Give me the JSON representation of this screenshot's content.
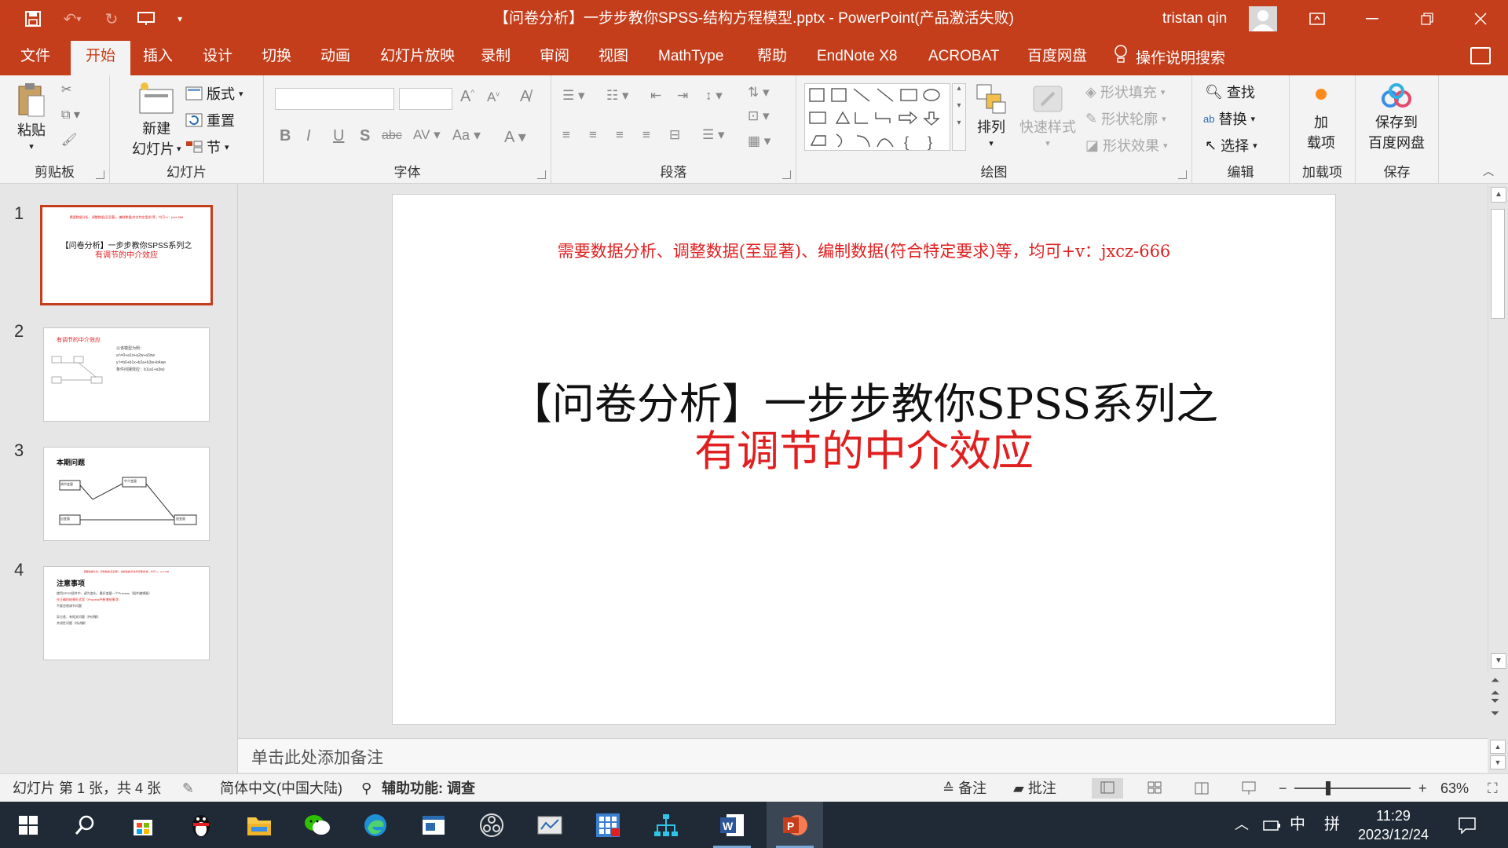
{
  "window": {
    "title": "【问卷分析】一步步教你SPSS-结构方程模型.pptx - PowerPoint(产品激活失败)",
    "user": "tristan qin"
  },
  "tabs": [
    "文件",
    "开始",
    "插入",
    "设计",
    "切换",
    "动画",
    "幻灯片放映",
    "录制",
    "审阅",
    "视图",
    "MathType",
    "帮助",
    "EndNote X8",
    "ACROBAT",
    "百度网盘"
  ],
  "active_tab": "开始",
  "tell_me": "操作说明搜索",
  "ribbon": {
    "groups": {
      "clipboard": "剪贴板",
      "slides": "幻灯片",
      "font": "字体",
      "paragraph": "段落",
      "drawing": "绘图",
      "editing": "编辑",
      "addins": "加载项",
      "save": "保存"
    },
    "paste": "粘贴",
    "new_slide_1": "新建",
    "new_slide_2": "幻灯片",
    "layout": "版式",
    "reset": "重置",
    "section": "节",
    "arrange": "排列",
    "quick_styles": "快速样式",
    "shape_fill": "形状填充",
    "shape_outline": "形状轮廓",
    "shape_effects": "形状效果",
    "find": "查找",
    "replace": "替换",
    "select": "选择",
    "addin_1": "加",
    "addin_2": "载项",
    "save_to_1": "保存到",
    "save_to_2": "百度网盘"
  },
  "slides": [
    {
      "number": "1",
      "banner": "需要数据分析、调整数据(至显著)、编制数据(符合特定要求)等，均可+v：jxcz-666",
      "line1": "【问卷分析】一步步教你SPSS系列之",
      "line2": "有调节的中介效应"
    },
    {
      "number": "2",
      "heading": "有调节的中介效应",
      "bullets": [
        "以该模型为例：",
        "a:\\=0+a1x+a2w+a3xw",
        "y:\\=b0+b1x+b2a+b3w+b4aw",
        "条件间接效应：b1(a1+a3w)"
      ]
    },
    {
      "number": "3",
      "heading": "本期问题",
      "boxes": [
        "自变量",
        "中介变量",
        "调节变量",
        "因变量"
      ]
    },
    {
      "number": "4",
      "heading": "注意事项",
      "bullets": [
        "使用SPSS插件中，调为变化，最好变量一个Process（插件编辑器）",
        "在正确的结果形式里（Process中新增结果项）",
        "不要忽视调节问题",
        "异方差，有相关问题（待讲解）",
        "共线性问题（待讲解）"
      ]
    }
  ],
  "current_slide": {
    "banner": "需要数据分析、调整数据(至显著)、编制数据(符合特定要求)等，均可+v：jxcz-666",
    "title_line1": "【问卷分析】一步步教你SPSS系列之",
    "title_line2": "有调节的中介效应"
  },
  "notes_placeholder": "单击此处添加备注",
  "status": {
    "slide_info": "幻灯片 第 1 张，共 4 张",
    "language": "简体中文(中国大陆)",
    "accessibility": "辅助功能: 调查",
    "notes": "备注",
    "comments": "批注",
    "zoom": "63%"
  },
  "taskbar": {
    "time": "11:29",
    "date": "2023/12/24",
    "ime": "中",
    "ime2": "拼"
  },
  "colors": {
    "accent": "#c43e1c",
    "slide_red": "#e02020"
  }
}
